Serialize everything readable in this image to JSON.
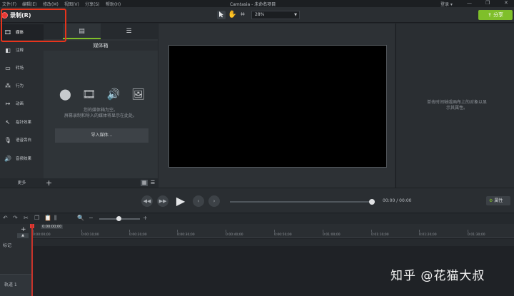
{
  "app": {
    "title": "Camtasia - 未命名项目",
    "menus": [
      "文件(F)",
      "编辑(E)",
      "修改(M)",
      "视图(V)",
      "分享(S)",
      "帮助(H)"
    ],
    "login": "登录 ▾",
    "window_controls": [
      "—",
      "❐",
      "✕"
    ]
  },
  "toolbar": {
    "record_label": "录制(R)",
    "zoom_value": "28%",
    "share_label": "分享",
    "tools": [
      "select-arrow-icon",
      "pan-hand-icon",
      "crop-icon"
    ]
  },
  "sidebar": {
    "items": [
      {
        "label": "媒体",
        "icon": "🎞"
      },
      {
        "label": "注释",
        "icon": "◧"
      },
      {
        "label": "转场",
        "icon": "▭"
      },
      {
        "label": "行为",
        "icon": "⁂"
      },
      {
        "label": "动画",
        "icon": "↦"
      },
      {
        "label": "指针效果",
        "icon": "↖"
      },
      {
        "label": "语音旁白",
        "icon": "🎙"
      },
      {
        "label": "音频效果",
        "icon": "🔊"
      }
    ],
    "more_label": "更多"
  },
  "media_bin": {
    "title": "媒体箱",
    "empty_text_line1": "您的媒体箱为空。",
    "empty_text_line2": "屏幕录制和导入的媒体将显示在此处。",
    "import_label": "导入媒体..."
  },
  "properties": {
    "hint_line1": "单击时间轴或画布上的对象以显",
    "hint_line2": "示其属性。",
    "button_label": "属性"
  },
  "playback": {
    "current_time": "00:00",
    "separator": "/",
    "total_time": "00:00"
  },
  "timeline": {
    "playhead_time": "0:00:00;00",
    "ticks": [
      "0:00:00;00",
      "0:00:10;00",
      "0:00:20;00",
      "0:00:30;00",
      "0:00:40;00",
      "0:00:50;00",
      "0:01:00;00",
      "0:01:10;00",
      "0:01:20;00",
      "0:01:30;00"
    ],
    "marker_label": "标记",
    "track_label": "轨道 1"
  },
  "watermark": "知乎 @花猫大叔",
  "colors": {
    "accent": "#7fbf2a",
    "record": "#e53935",
    "highlight": "#e8341c"
  }
}
